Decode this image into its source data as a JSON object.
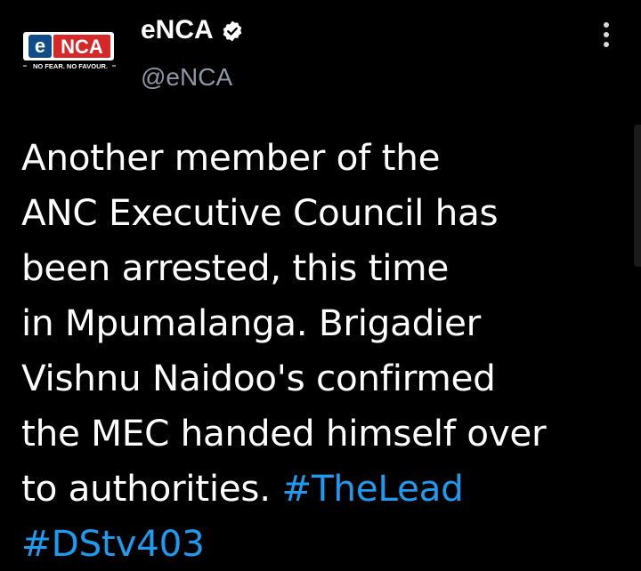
{
  "author": {
    "name": "eNCA",
    "handle": "@eNCA",
    "verified": true,
    "avatar": {
      "logo_text": "eNCA",
      "tagline": "NO FEAR. NO FAVOUR.",
      "colors": {
        "logo_bg": "#ffffff",
        "e_badge": "#0f4c8a",
        "nca_box": "#d62828",
        "tagline": "#1a1a1a"
      }
    }
  },
  "menu": {
    "icon": "more-vertical-icon"
  },
  "tweet": {
    "lines": [
      {
        "text": "Another member of the"
      },
      {
        "text": "ANC Executive Council has"
      },
      {
        "text": "been arrested, this time"
      },
      {
        "text": "in Mpumalanga. Brigadier"
      },
      {
        "text": "Vishnu Naidoo's confirmed"
      },
      {
        "text": "the MEC handed himself over"
      },
      {
        "text": "to authorities. ",
        "hashtag": "#TheLead"
      },
      {
        "text": "",
        "hashtag": "#DStv403"
      }
    ]
  },
  "colors": {
    "background": "#000000",
    "text": "#ffffff",
    "handle": "#8b98a5",
    "hashtag": "#1d9bf0",
    "verified": "#ffffff"
  }
}
